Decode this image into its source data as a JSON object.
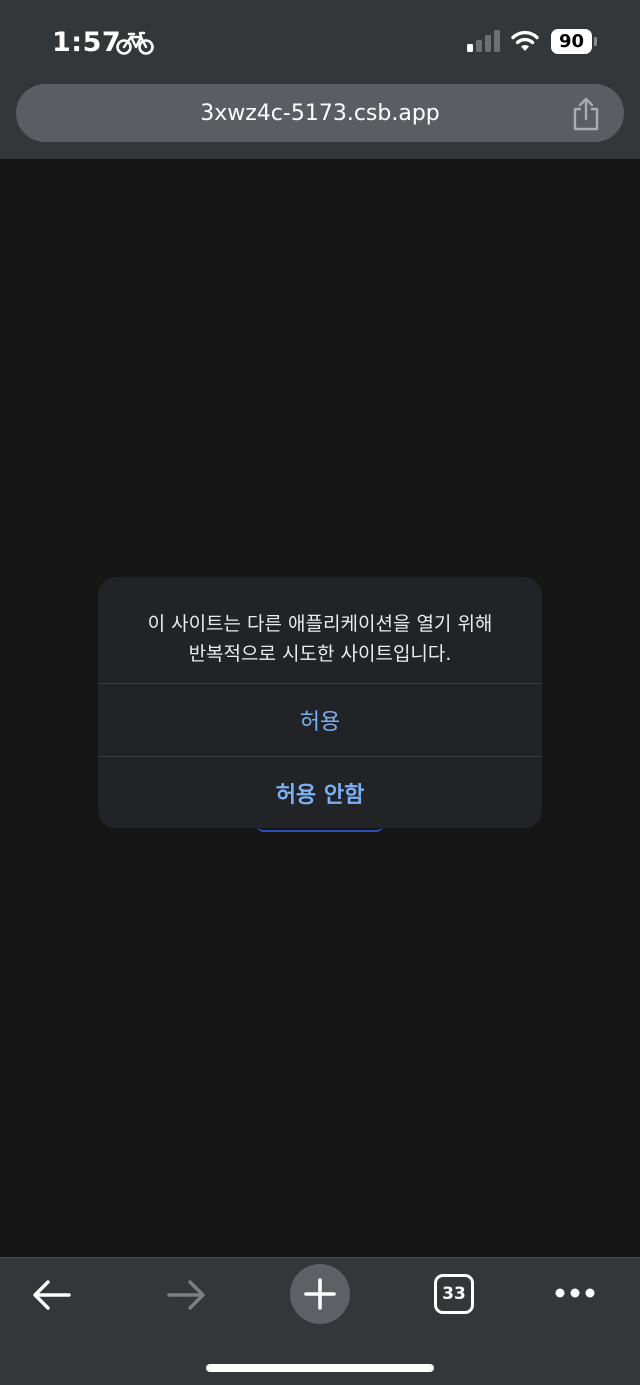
{
  "status_bar": {
    "time": "1:57",
    "battery_level": "90",
    "icons": [
      "bicycle-icon",
      "cellular-signal-icon",
      "wifi-icon",
      "battery-icon"
    ]
  },
  "browser": {
    "url": "3xwz4c-5173.csb.app",
    "tab_count": "33",
    "toolbar_icons": [
      "back-arrow-icon",
      "forward-arrow-icon",
      "plus-icon",
      "tabs-icon",
      "more-icon",
      "share-icon"
    ]
  },
  "dialog": {
    "message_line1": "이 사이트는 다른 애플리케이션을 열기 위해",
    "message_line2": "반복적으로 시도한 사이트입니다.",
    "allow_label": "허용",
    "deny_label": "허용 안함"
  },
  "colors": {
    "chrome": "#34373a",
    "background": "#161617",
    "dialog": "#222326",
    "accent": "#7ab0f5"
  }
}
